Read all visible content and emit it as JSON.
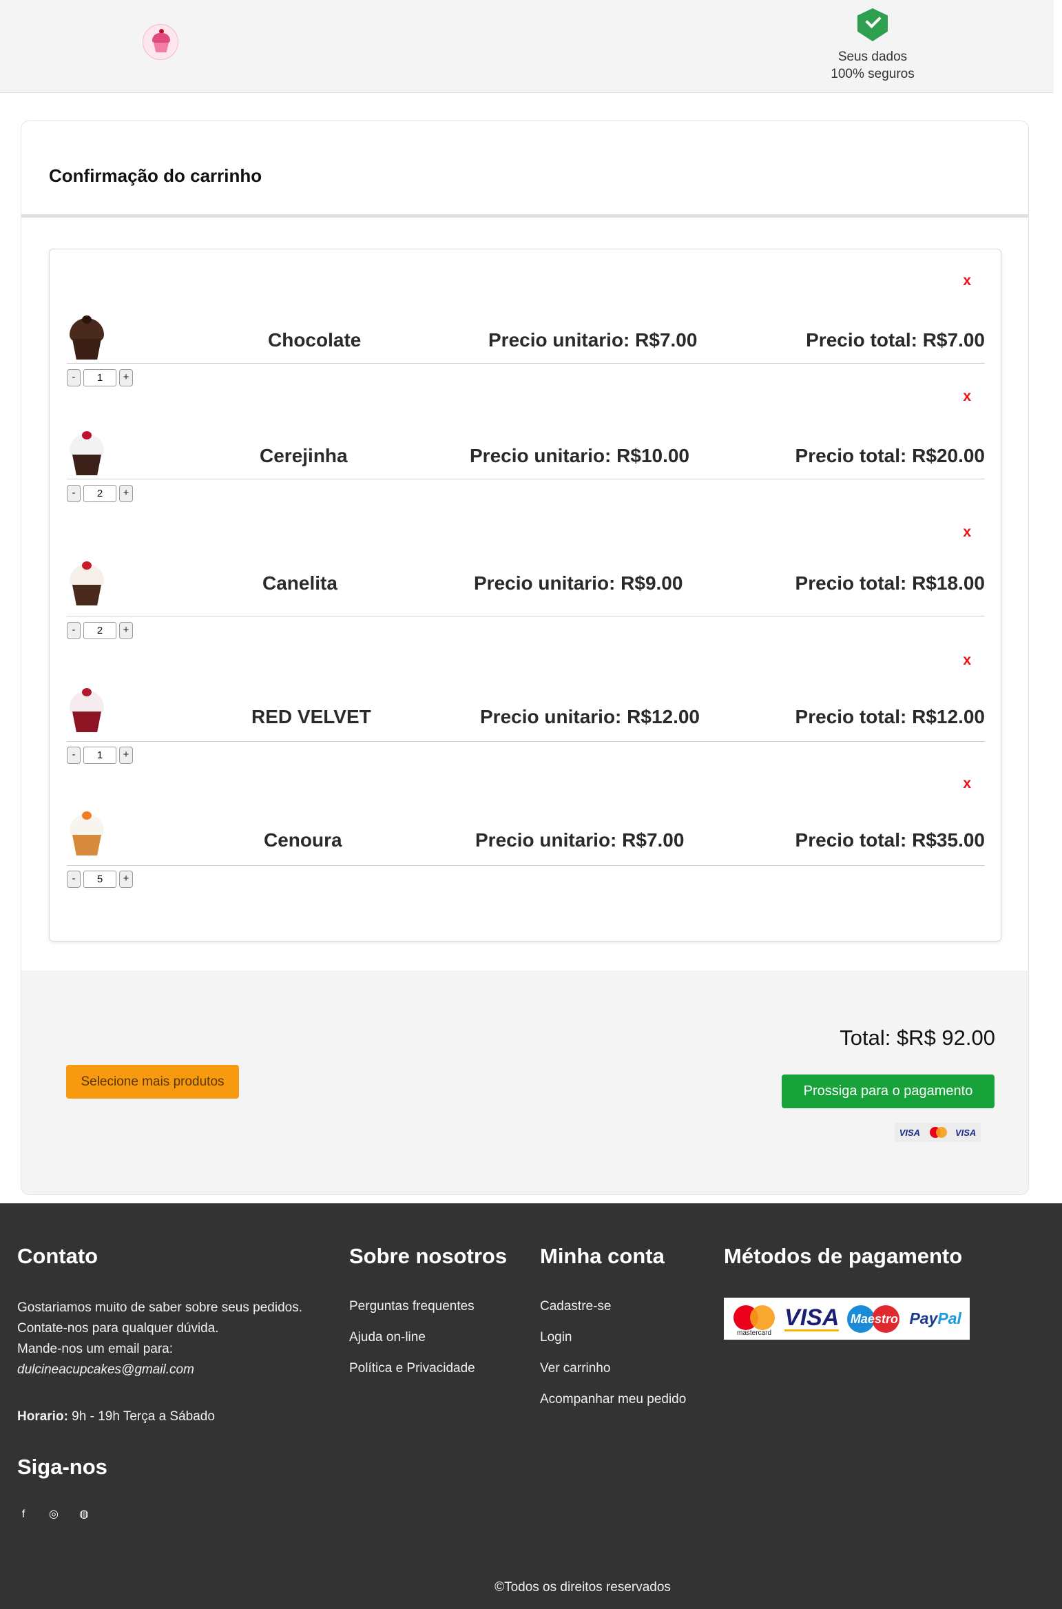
{
  "header": {
    "logo_alt": "Dulcinea Cupcakes",
    "secure_line1": "Seus dados",
    "secure_line2": "100% seguros"
  },
  "cart": {
    "title": "Confirmação do carrinho",
    "remove_label": "x",
    "items": [
      {
        "name": "Chocolate",
        "unit_price": "Precio unitario: R$7.00",
        "total_price": "Precio total: R$7.00",
        "qty": "1",
        "colors": {
          "frost": "#4a2a1c",
          "wrap": "#3b1f14",
          "top": "#2a140c"
        }
      },
      {
        "name": "Cerejinha",
        "unit_price": "Precio unitario: R$10.00",
        "total_price": "Precio total: R$20.00",
        "qty": "2",
        "colors": {
          "frost": "#f2f2f2",
          "wrap": "#3b2018",
          "top": "#c0102f"
        }
      },
      {
        "name": "Canelita",
        "unit_price": "Precio unitario: R$9.00",
        "total_price": "Precio total: R$18.00",
        "qty": "2",
        "colors": {
          "frost": "#f6f0ea",
          "wrap": "#4a2a1c",
          "top": "#c81b2a"
        }
      },
      {
        "name": "RED VELVET",
        "unit_price": "Precio unitario: R$12.00",
        "total_price": "Precio total: R$12.00",
        "qty": "1",
        "colors": {
          "frost": "#f4ecee",
          "wrap": "#8e1424",
          "top": "#b01a2c"
        }
      },
      {
        "name": "Cenoura",
        "unit_price": "Precio unitario: R$7.00",
        "total_price": "Precio total: R$35.00",
        "qty": "5",
        "colors": {
          "frost": "#f8f4ee",
          "wrap": "#d88a3c",
          "top": "#f47c20"
        }
      }
    ],
    "qty_minus": "-",
    "qty_plus": "+"
  },
  "summary": {
    "more_products_label": "Selecione mais produtos",
    "total_label": "Total: $R$ 92.00",
    "pay_label": "Prossiga para o pagamento",
    "mini_visa_1": "VISA",
    "mini_visa_2": "VISA"
  },
  "footer": {
    "contact": {
      "heading": "Contato",
      "line1": "Gostariamos muito de saber sobre seus pedidos.",
      "line2": "Contate-nos para qualquer dúvida.",
      "line3": "Mande-nos um email para:",
      "email": "dulcineacupcakes@gmail.com",
      "hours_label": "Horario:",
      "hours_value": " 9h - 19h Terça a Sábado"
    },
    "about": {
      "heading": "Sobre nosotros",
      "links": [
        "Perguntas frequentes",
        "Ajuda on-line",
        "Política e Privacidade"
      ]
    },
    "account": {
      "heading": "Minha conta",
      "links": [
        "Cadastre-se",
        "Login",
        "Ver carrinho",
        "Acompanhar meu pedido"
      ]
    },
    "payments": {
      "heading": "Métodos de pagamento",
      "mastercard": "mastercard",
      "visa": "VISA",
      "maestro": "Maestro",
      "paypal_pay": "Pay",
      "paypal_pal": "Pal"
    },
    "follow": {
      "heading": "Siga-nos",
      "icons": [
        "facebook-icon",
        "instagram-icon",
        "globe-icon"
      ]
    },
    "copyright": "©Todos os direitos reservados"
  }
}
